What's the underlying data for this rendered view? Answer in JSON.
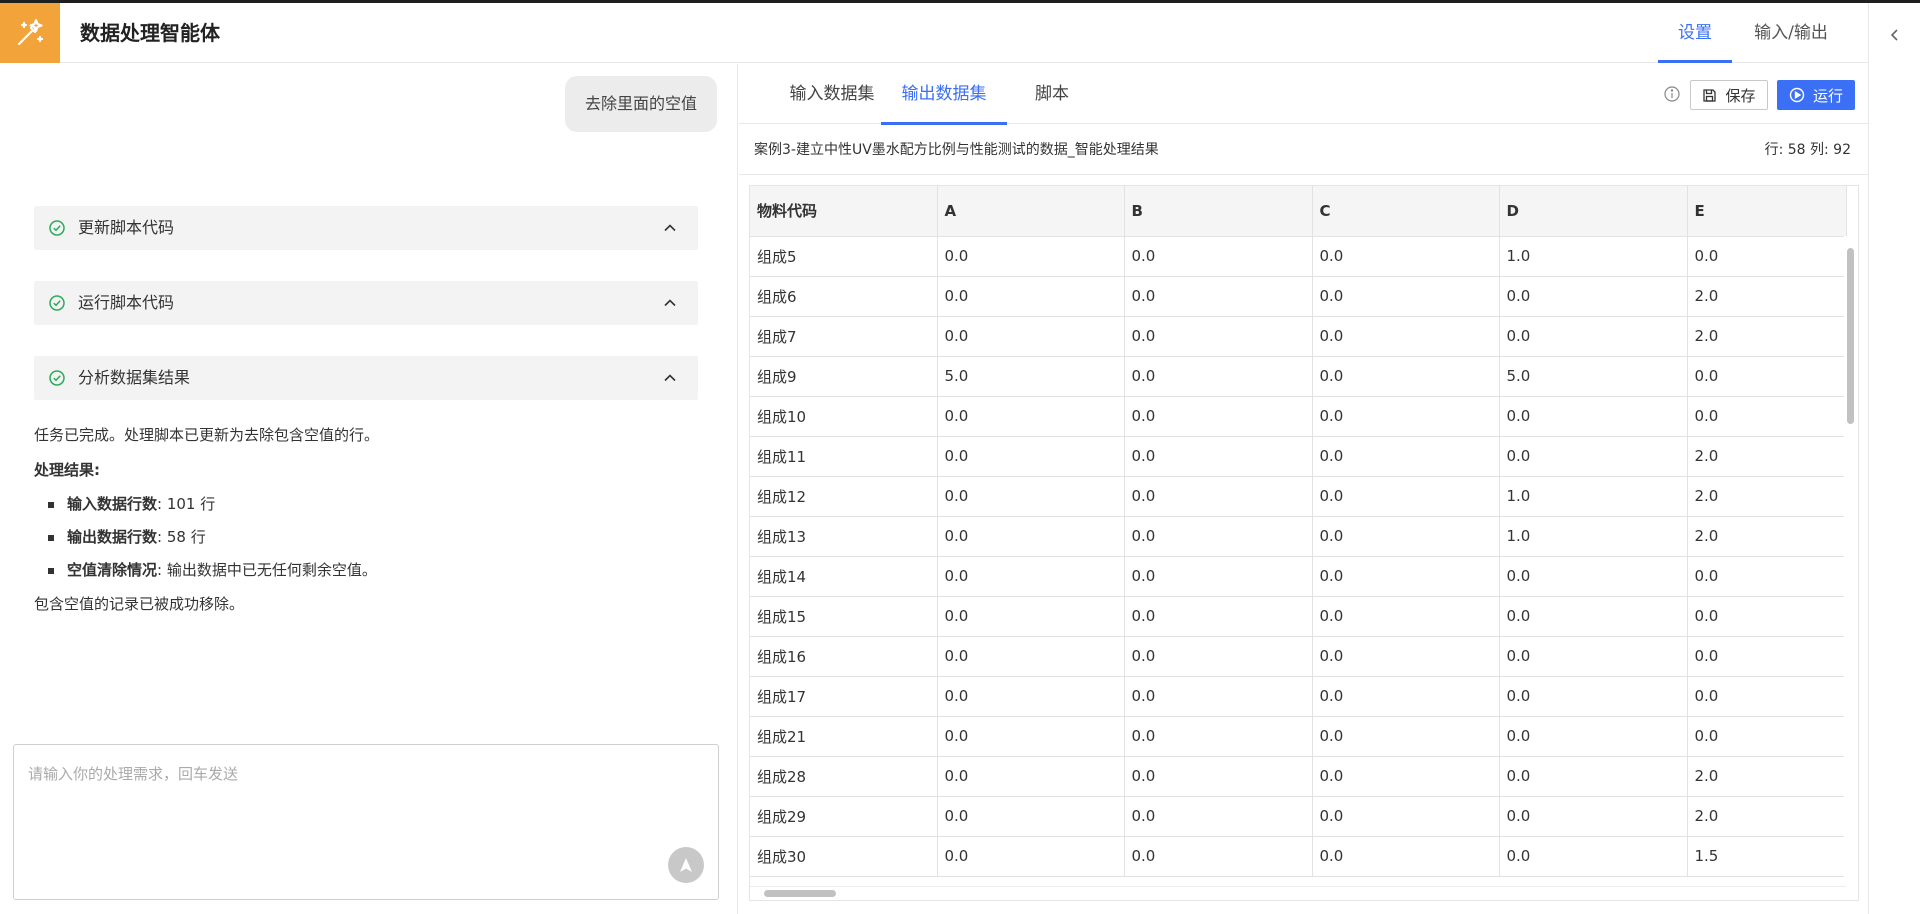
{
  "app": {
    "title": "数据处理智能体"
  },
  "header": {
    "tabs": [
      {
        "label": "设置",
        "active": true
      },
      {
        "label": "输入/输出",
        "active": false
      }
    ]
  },
  "icons": {
    "logo": "magic-wand-icon",
    "collapse": "chevron-left-icon",
    "step_status": "check-circle-icon",
    "step_toggle": "chevron-up-icon",
    "send": "navigation-arrow-icon",
    "info": "info-circle-icon",
    "save": "floppy-disk-icon",
    "run": "play-circle-icon"
  },
  "colors": {
    "accent": "#3b6ff5",
    "logo_bg": "#f2a33a",
    "success": "#2eaa5c"
  },
  "chat": {
    "user_message": "去除里面的空值",
    "steps": [
      {
        "label": "更新脚本代码"
      },
      {
        "label": "运行脚本代码"
      },
      {
        "label": "分析数据集结果"
      }
    ],
    "result": {
      "intro": "任务已完成。处理脚本已更新为去除包含空值的行。",
      "heading": "处理结果:",
      "items": [
        {
          "key": "输入数据行数",
          "value": ": 101 行"
        },
        {
          "key": "输出数据行数",
          "value": ": 58 行"
        },
        {
          "key": "空值清除情况",
          "value": ": 输出数据中已无任何剩余空值。"
        }
      ],
      "conclusion": "包含空值的记录已被成功移除。"
    },
    "input": {
      "placeholder": "请输入你的处理需求，回车发送",
      "value": ""
    }
  },
  "panel": {
    "tabs": [
      {
        "label": "输入数据集",
        "active": false
      },
      {
        "label": "输出数据集",
        "active": true
      },
      {
        "label": "脚本",
        "active": false
      }
    ],
    "save_label": "保存",
    "run_label": "运行",
    "dataset_name": "案例3-建立中性UV墨水配方比例与性能测试的数据_智能处理结果",
    "dataset_stats": "行: 58 列: 92"
  },
  "table": {
    "columns": [
      "物料代码",
      "A",
      "B",
      "C",
      "D",
      "E"
    ],
    "rows": [
      [
        "组成5",
        "0.0",
        "0.0",
        "0.0",
        "1.0",
        "0.0"
      ],
      [
        "组成6",
        "0.0",
        "0.0",
        "0.0",
        "0.0",
        "2.0"
      ],
      [
        "组成7",
        "0.0",
        "0.0",
        "0.0",
        "0.0",
        "2.0"
      ],
      [
        "组成9",
        "5.0",
        "0.0",
        "0.0",
        "5.0",
        "0.0"
      ],
      [
        "组成10",
        "0.0",
        "0.0",
        "0.0",
        "0.0",
        "0.0"
      ],
      [
        "组成11",
        "0.0",
        "0.0",
        "0.0",
        "0.0",
        "2.0"
      ],
      [
        "组成12",
        "0.0",
        "0.0",
        "0.0",
        "1.0",
        "2.0"
      ],
      [
        "组成13",
        "0.0",
        "0.0",
        "0.0",
        "1.0",
        "2.0"
      ],
      [
        "组成14",
        "0.0",
        "0.0",
        "0.0",
        "0.0",
        "0.0"
      ],
      [
        "组成15",
        "0.0",
        "0.0",
        "0.0",
        "0.0",
        "0.0"
      ],
      [
        "组成16",
        "0.0",
        "0.0",
        "0.0",
        "0.0",
        "0.0"
      ],
      [
        "组成17",
        "0.0",
        "0.0",
        "0.0",
        "0.0",
        "0.0"
      ],
      [
        "组成21",
        "0.0",
        "0.0",
        "0.0",
        "0.0",
        "0.0"
      ],
      [
        "组成28",
        "0.0",
        "0.0",
        "0.0",
        "0.0",
        "2.0"
      ],
      [
        "组成29",
        "0.0",
        "0.0",
        "0.0",
        "0.0",
        "2.0"
      ],
      [
        "组成30",
        "0.0",
        "0.0",
        "0.0",
        "0.0",
        "1.5"
      ]
    ]
  }
}
